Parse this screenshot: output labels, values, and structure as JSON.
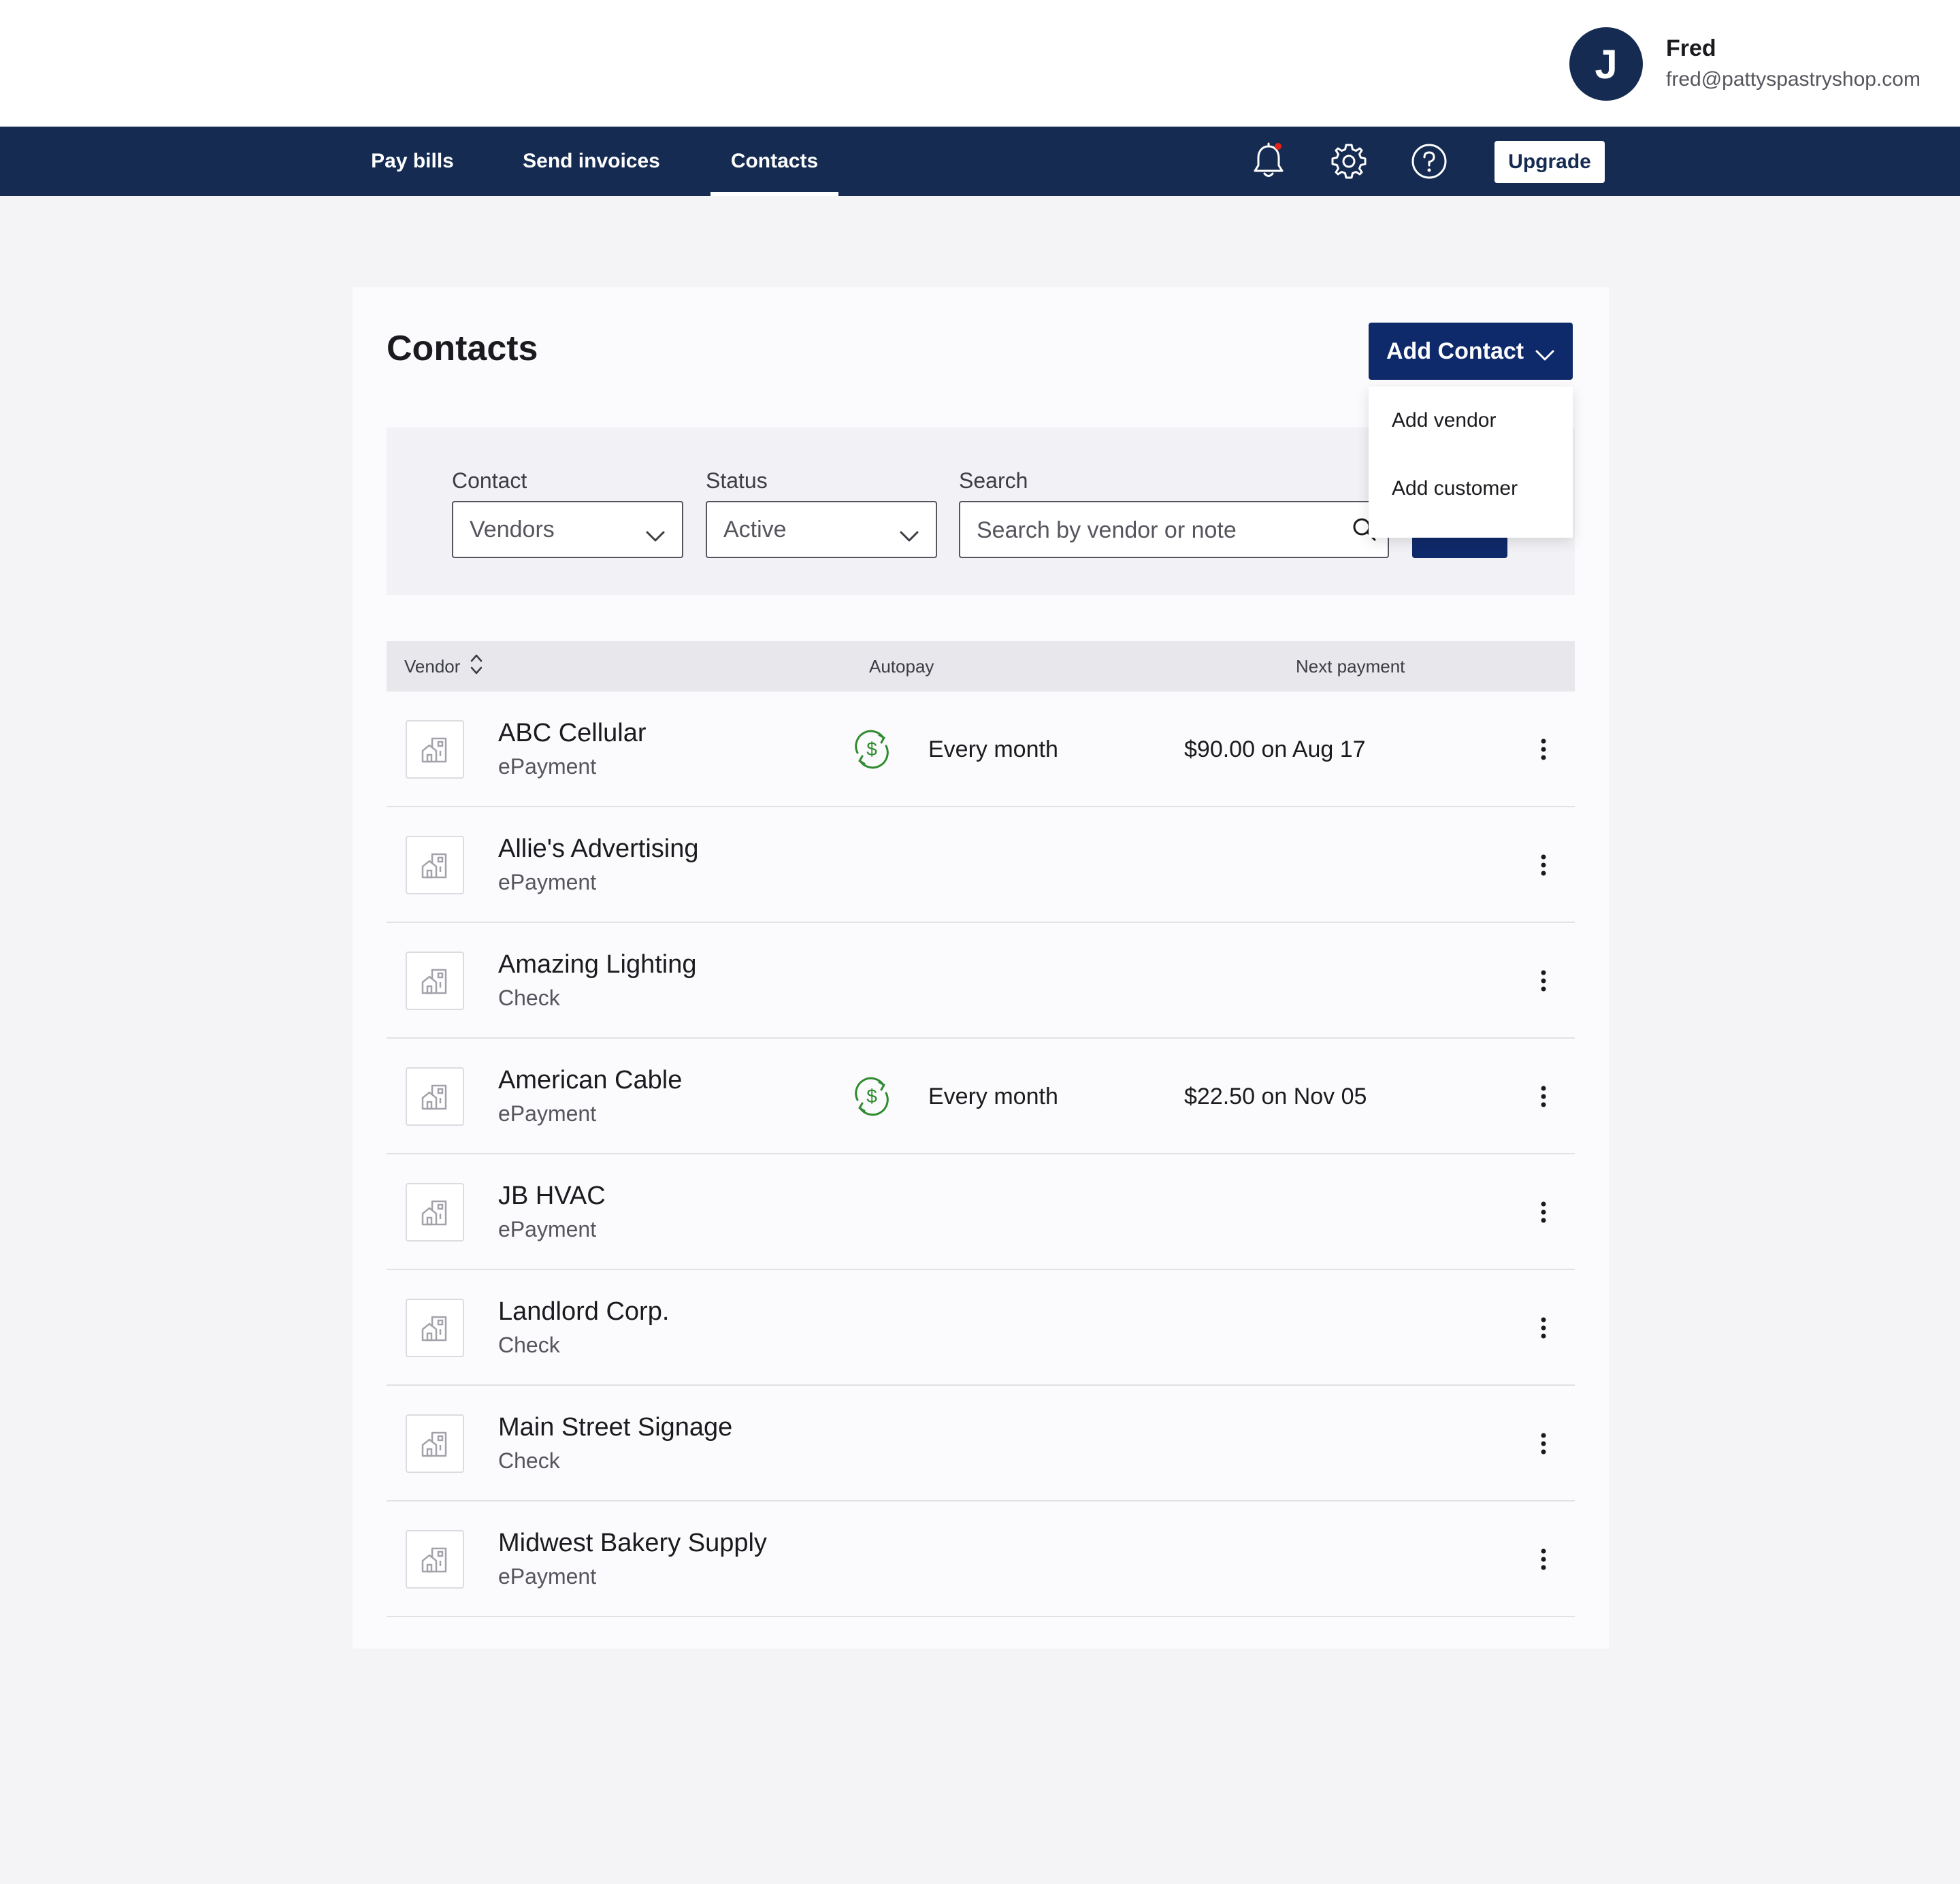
{
  "user": {
    "initial": "J",
    "name": "Fred",
    "email": "fred@pattyspastryshop.com"
  },
  "nav": {
    "tabs": [
      {
        "label": "Pay bills",
        "active": false
      },
      {
        "label": "Send invoices",
        "active": false
      },
      {
        "label": "Contacts",
        "active": true
      }
    ],
    "icons": [
      "bell-icon",
      "gear-icon",
      "help-icon"
    ],
    "upgrade_label": "Upgrade",
    "notification_dot_color": "#e2231a"
  },
  "page": {
    "title": "Contacts",
    "add_contact_label": "Add Contact",
    "add_contact_menu": [
      "Add vendor",
      "Add customer"
    ]
  },
  "filters": {
    "contact_label": "Contact",
    "contact_value": "Vendors",
    "status_label": "Status",
    "status_value": "Active",
    "search_label": "Search",
    "search_placeholder": "Search by vendor or note"
  },
  "table": {
    "columns": [
      "Vendor",
      "Autopay",
      "Next payment"
    ],
    "rows": [
      {
        "name": "ABC Cellular",
        "method": "ePayment",
        "autopay": "Every month",
        "next_payment": "$90.00 on Aug 17"
      },
      {
        "name": "Allie's Advertising",
        "method": "ePayment",
        "autopay": "",
        "next_payment": ""
      },
      {
        "name": "Amazing Lighting",
        "method": "Check",
        "autopay": "",
        "next_payment": ""
      },
      {
        "name": "American Cable",
        "method": "ePayment",
        "autopay": "Every month",
        "next_payment": "$22.50 on Nov 05"
      },
      {
        "name": "JB HVAC",
        "method": "ePayment",
        "autopay": "",
        "next_payment": ""
      },
      {
        "name": "Landlord Corp.",
        "method": "Check",
        "autopay": "",
        "next_payment": ""
      },
      {
        "name": "Main Street Signage",
        "method": "Check",
        "autopay": "",
        "next_payment": ""
      },
      {
        "name": "Midwest Bakery Supply",
        "method": "ePayment",
        "autopay": "",
        "next_payment": ""
      }
    ]
  },
  "colors": {
    "navy": "#152b52",
    "primary_button": "#0f2a6b",
    "autopay_green": "#2e8b2e"
  }
}
